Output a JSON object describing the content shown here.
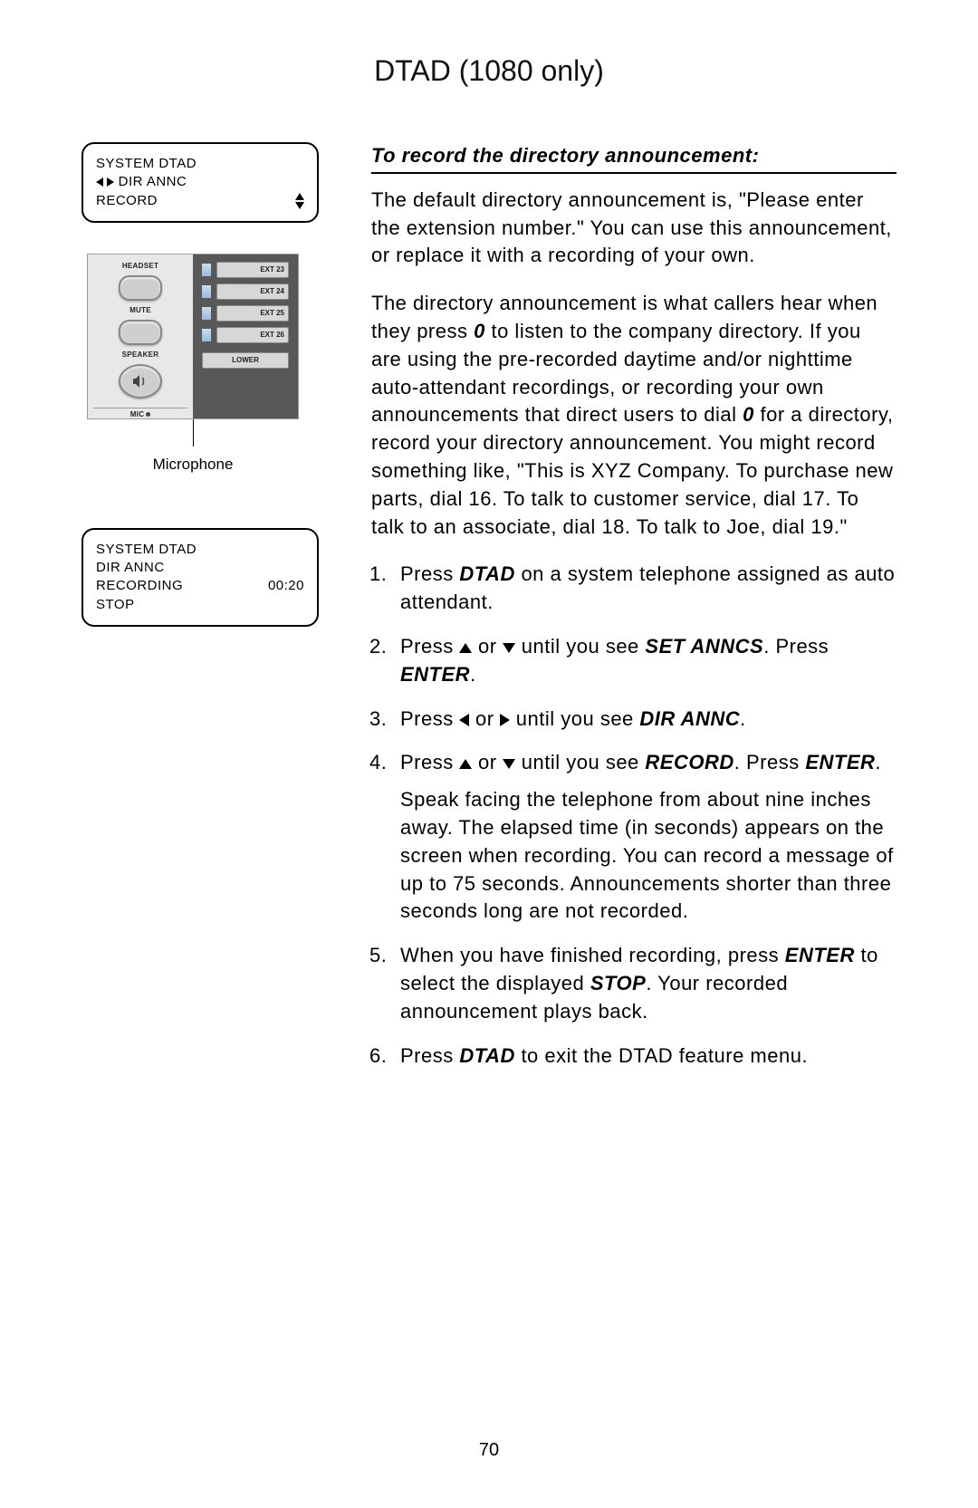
{
  "header": {
    "title": "DTAD (1080 only)"
  },
  "lcd1": {
    "line1": "SYSTEM DTAD",
    "line2_prefix_arrows": true,
    "line2": "DIR ANNC",
    "line3": "RECORD"
  },
  "phone": {
    "labels": {
      "headset": "HEADSET",
      "mute": "MUTE",
      "speaker": "SPEAKER",
      "mic": "MIC",
      "lower": "LOWER"
    },
    "ext": [
      "EXT 23",
      "EXT 24",
      "EXT 25",
      "EXT 26"
    ],
    "caption": "Microphone"
  },
  "lcd2": {
    "line1": "SYSTEM DTAD",
    "line2": "DIR ANNC",
    "line3_left": "RECORDING",
    "line3_right": "00:20",
    "line4": "STOP"
  },
  "content": {
    "section_title": "To record the directory announcement:",
    "p1": "The default directory announcement is, \"Please enter the extension number.\" You can use this announcement, or replace it with a recording of your own.",
    "p2_a": "The directory announcement is what callers hear when they press ",
    "p2_key": "0",
    "p2_b": " to listen to the company directory. If you are using the pre-recorded daytime and/or nighttime auto-attendant recordings, or recording your own announcements that direct users to dial ",
    "p2_key2": "0",
    "p2_c": " for a directory, record your directory announcement. You might record something like, \"This is XYZ Company. To purchase new parts, dial 16. To talk to customer service, dial 17. To talk to an associate, dial 18. To talk to Joe, dial 19.\"",
    "steps": {
      "s1_a": "Press ",
      "s1_key": "DTAD",
      "s1_b": " on a system telephone assigned as auto attendant.",
      "s2_a": "Press ",
      "s2_b": " or ",
      "s2_c": " until you see ",
      "s2_target": "SET ANNCS",
      "s2_d": ". Press ",
      "s2_enter": "ENTER",
      "s2_e": ".",
      "s3_a": "Press ",
      "s3_b": " or ",
      "s3_c": " until you see ",
      "s3_target": "DIR ANNC",
      "s3_d": ".",
      "s4_a": "Press ",
      "s4_b": " or ",
      "s4_c": " until you see ",
      "s4_target": "RECORD",
      "s4_d": ". Press ",
      "s4_enter": "ENTER",
      "s4_e": ".",
      "s4_para": "Speak facing the telephone from about nine inches away. The elapsed time (in seconds) appears on the screen when recording. You can record a message of up to 75 seconds. Announcements shorter than three seconds long are not recorded.",
      "s5_a": "When you have finished recording, press ",
      "s5_enter": "ENTER",
      "s5_b": " to select the displayed ",
      "s5_stop": "STOP",
      "s5_c": ". Your recorded announcement plays back.",
      "s6_a": "Press ",
      "s6_key": "DTAD",
      "s6_b": " to exit the DTAD feature menu."
    }
  },
  "pagenum": "70"
}
